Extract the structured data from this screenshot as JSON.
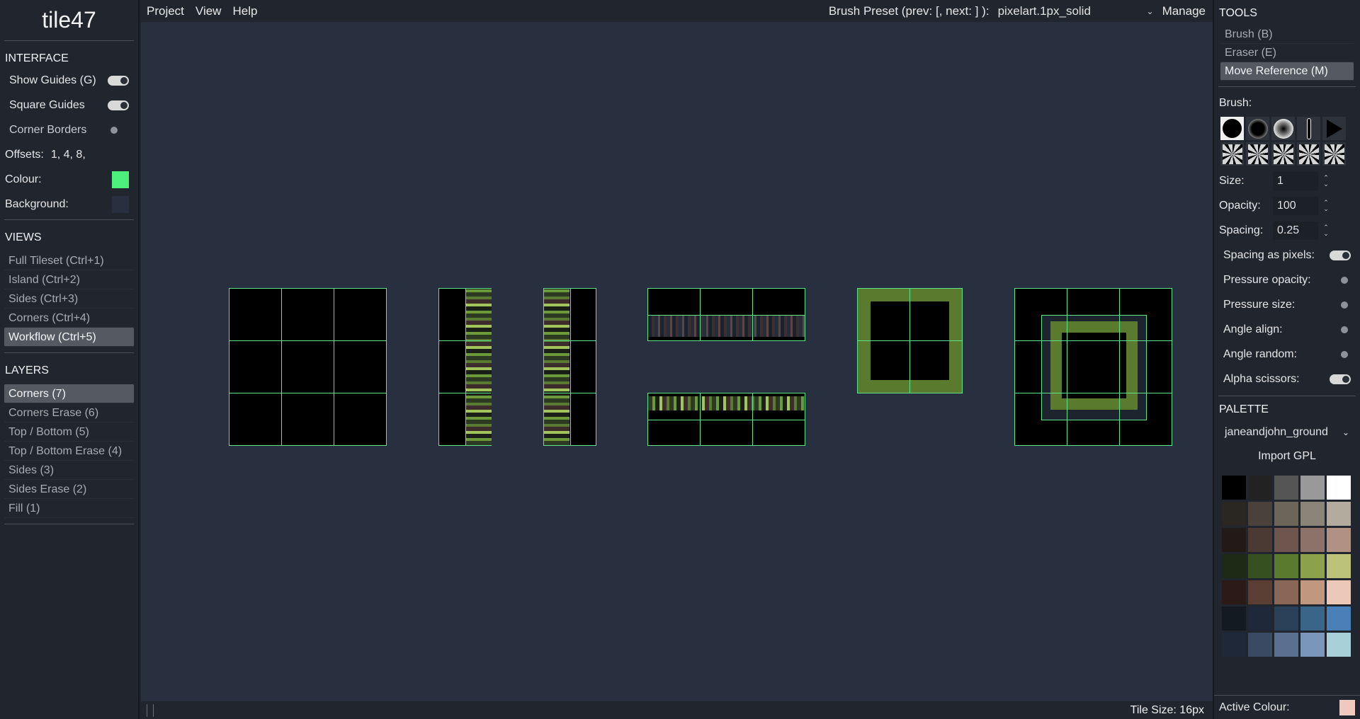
{
  "app": {
    "title": "tile47"
  },
  "interface": {
    "heading": "INTERFACE",
    "show_guides": "Show Guides (G)",
    "square_guides": "Square Guides",
    "corner_borders": "Corner Borders",
    "offsets_label": "Offsets:",
    "offsets_value": "1, 4, 8,",
    "colour_label": "Colour:",
    "colour_value": "#4cf07a",
    "background_label": "Background:",
    "background_value": "#283040"
  },
  "views": {
    "heading": "VIEWS",
    "items": [
      {
        "label": "Full Tileset (Ctrl+1)"
      },
      {
        "label": "Island (Ctrl+2)"
      },
      {
        "label": "Sides (Ctrl+3)"
      },
      {
        "label": "Corners (Ctrl+4)"
      },
      {
        "label": "Workflow (Ctrl+5)"
      }
    ],
    "selected_index": 4
  },
  "layers": {
    "heading": "LAYERS",
    "items": [
      {
        "label": "Corners (7)"
      },
      {
        "label": "Corners Erase (6)"
      },
      {
        "label": "Top / Bottom (5)"
      },
      {
        "label": "Top / Bottom Erase (4)"
      },
      {
        "label": "Sides (3)"
      },
      {
        "label": "Sides Erase (2)"
      },
      {
        "label": "Fill (1)"
      }
    ],
    "selected_index": 0
  },
  "menu": {
    "project": "Project",
    "view": "View",
    "help": "Help"
  },
  "brush_preset": {
    "label": "Brush Preset (prev: [, next: ] ):",
    "value": "pixelart.1px_solid",
    "manage": "Manage"
  },
  "tools": {
    "heading": "TOOLS",
    "items": [
      {
        "label": "Brush (B)"
      },
      {
        "label": "Eraser (E)"
      },
      {
        "label": "Move Reference (M)"
      }
    ],
    "selected_index": 2
  },
  "brush": {
    "label": "Brush:",
    "presets": [
      "hard-round",
      "soft-round",
      "airbrush",
      "line",
      "triangle",
      "texture-1",
      "texture-2",
      "texture-3",
      "texture-4",
      "texture-5"
    ],
    "selected_index": 0,
    "size_label": "Size:",
    "size": "1",
    "opacity_label": "Opacity:",
    "opacity": "100",
    "spacing_label": "Spacing:",
    "spacing": "0.25",
    "spacing_pixels": "Spacing as pixels:",
    "pressure_opacity": "Pressure opacity:",
    "pressure_size": "Pressure size:",
    "angle_align": "Angle align:",
    "angle_random": "Angle random:",
    "alpha_scissors": "Alpha scissors:"
  },
  "palette": {
    "heading": "PALETTE",
    "name": "janeandjohn_ground",
    "import": "Import GPL",
    "colors": [
      "#000000",
      "#222222",
      "#555555",
      "#999999",
      "#ffffff",
      "#2a2622",
      "#4a423a",
      "#6b655a",
      "#8a8478",
      "#b2ab9e",
      "#231916",
      "#4b3a34",
      "#6e554d",
      "#8c7268",
      "#b09184",
      "#1c2a16",
      "#37501f",
      "#5a7a2e",
      "#8aa34a",
      "#bcc27a",
      "#2c1a16",
      "#5a3e34",
      "#8a6656",
      "#c09880",
      "#ecc8b8",
      "#141a22",
      "#1e2838",
      "#2a4058",
      "#3a6488",
      "#4a80b8",
      "#1e2838",
      "#3a4a62",
      "#5a7090",
      "#7a96b8",
      "#a8d0d8"
    ],
    "active_label": "Active Colour:",
    "active_value": "#f0c8c0"
  },
  "status": {
    "tile_size": "Tile Size: 16px"
  }
}
